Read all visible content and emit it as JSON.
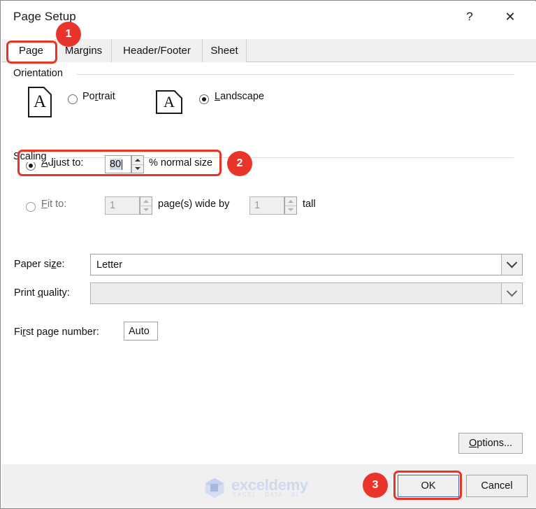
{
  "window": {
    "title": "Page Setup",
    "help_icon": "?",
    "close_icon": "✕"
  },
  "tabs": [
    {
      "label": "Page",
      "active": true
    },
    {
      "label": "Margins",
      "active": false
    },
    {
      "label": "Header/Footer",
      "active": false
    },
    {
      "label": "Sheet",
      "active": false
    }
  ],
  "orientation": {
    "group_label": "Orientation",
    "portrait": {
      "label": "Portrait",
      "accel": "P",
      "selected": false,
      "icon": "portrait-page-icon",
      "glyph": "A"
    },
    "landscape": {
      "label": "Landscape",
      "accel": "L",
      "selected": true,
      "icon": "landscape-page-icon",
      "glyph": "A"
    }
  },
  "scaling": {
    "group_label": "Scaling",
    "adjust": {
      "label": "Adjust to:",
      "selected": true,
      "value": "80",
      "suffix": "% normal size",
      "enabled": true
    },
    "fit": {
      "label": "Fit to:",
      "selected": false,
      "wide_value": "1",
      "middle_text": "page(s) wide by",
      "tall_value": "1",
      "tall_text": "tall",
      "enabled": false
    }
  },
  "paper": {
    "paper_size_label": "Paper size:",
    "paper_size_value": "Letter",
    "print_quality_label": "Print quality:",
    "print_quality_value": "",
    "print_quality_enabled": false,
    "first_page_label": "First page number:",
    "first_page_value": "Auto"
  },
  "buttons": {
    "options": "Options...",
    "ok": "OK",
    "cancel": "Cancel"
  },
  "annotations": {
    "badge1": "1",
    "badge2": "2",
    "badge3": "3",
    "accent_color": "#e8342a"
  },
  "watermark": {
    "name": "exceldemy",
    "tagline": "EXCEL · DATA · BI"
  }
}
